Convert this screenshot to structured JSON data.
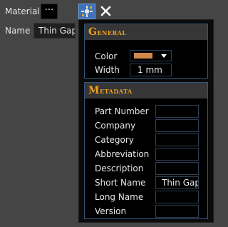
{
  "properties": {
    "material_label": "Material",
    "material_button": "···",
    "name_label": "Name",
    "name_value": "Thin Gap"
  },
  "toolbar": {
    "picker_icon": "material-picker-icon",
    "close_icon": "close-icon",
    "close_glyph": "✕"
  },
  "panel": {
    "general": {
      "title_cap": "G",
      "title_rest": "eneral",
      "color_label": "Color",
      "color_value": "#d0894a",
      "width_label": "Width",
      "width_value": "1 mm"
    },
    "metadata": {
      "title_cap": "M",
      "title_rest": "etadata",
      "fields": [
        {
          "label": "Part Number",
          "value": ""
        },
        {
          "label": "Company",
          "value": ""
        },
        {
          "label": "Category",
          "value": ""
        },
        {
          "label": "Abbreviation",
          "value": ""
        },
        {
          "label": "Description",
          "value": ""
        },
        {
          "label": "Short Name",
          "value": "Thin Gap"
        },
        {
          "label": "Long Name",
          "value": ""
        },
        {
          "label": "Version",
          "value": ""
        }
      ]
    }
  },
  "colors": {
    "accent_header": "#f0a01e",
    "button_blue": "#3f72b8",
    "swatch": "#d0894a"
  }
}
